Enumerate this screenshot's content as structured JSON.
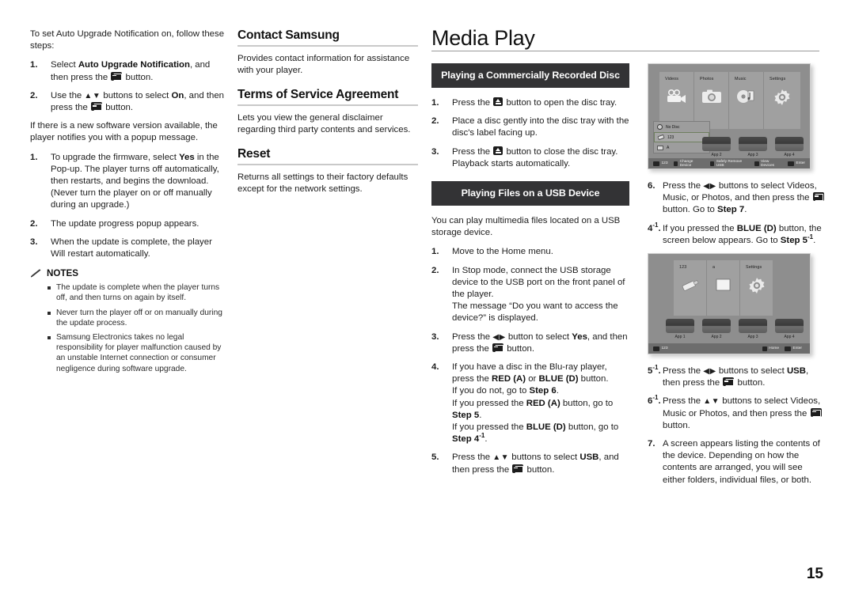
{
  "page": {
    "title": "Media Play",
    "number": "15"
  },
  "column1": {
    "intro": "To set Auto Upgrade Notification on, follow these steps:",
    "steps_a": [
      {
        "num": "1.",
        "parts": [
          "Select ",
          "Auto Upgrade Notification",
          ", and then press the ",
          "[ENTER]",
          " button."
        ]
      },
      {
        "num": "2.",
        "parts": [
          "Use the ",
          "▲▼",
          " buttons to select ",
          "On",
          ", and then press the ",
          "[ENTER]",
          " button."
        ]
      }
    ],
    "middle": "If there is a new software version available, the player notifies you with a popup message.",
    "steps_b": [
      {
        "num": "1.",
        "parts": [
          "To upgrade the firmware, select ",
          "Yes",
          " in the Pop-up. The player turns off automatically, then restarts, and begins the download. (Never turn the player on or off manually during an upgrade.)"
        ]
      },
      {
        "num": "2.",
        "parts": [
          "The update progress popup appears."
        ]
      },
      {
        "num": "3.",
        "parts": [
          "When the update is complete, the player Will restart automatically."
        ]
      }
    ],
    "notes_title": "NOTES",
    "notes": [
      "The update is complete when the player turns off, and then turns on again  by itself.",
      "Never turn the player off or on manually during the update process.",
      "Samsung Electronics takes no legal responsibility for player malfunction caused by an unstable Internet connection or consumer negligence during software upgrade."
    ]
  },
  "column2": {
    "sections": [
      {
        "heading": "Contact Samsung",
        "body": "Provides contact information for assistance with your player."
      },
      {
        "heading": "Terms of Service Agreement",
        "body": "Lets you view the general disclaimer regarding third party contents and services."
      },
      {
        "heading": "Reset",
        "body": "Returns all settings to their factory defaults except for the network settings."
      }
    ]
  },
  "column3": {
    "banner1": "Playing a Commercially Recorded Disc",
    "disc_steps": [
      {
        "num": "1.",
        "pre": "Press the ",
        "icon": "eject-button",
        "post": " button to open the disc tray."
      },
      {
        "num": "2.",
        "pre": "Place a disc gently into the disc tray with the disc's label facing up.",
        "icon": "",
        "post": ""
      },
      {
        "num": "3.",
        "pre": "Press the ",
        "icon": "eject-button",
        "post": " button to close the disc tray. Playback starts automatically."
      }
    ],
    "banner2": "Playing Files on a USB Device",
    "usb_intro": "You can play multimedia files located on a USB storage device.",
    "usb_steps": [
      {
        "num": "1.",
        "text": "Move to the Home menu."
      },
      {
        "num": "2.",
        "text": "In Stop mode, connect the USB storage device to the USB port on the front panel of the player. The message “Do you want to access the device?” is displayed."
      },
      {
        "num": "3.",
        "text": "Press the ◀▶ button to select Yes, and then press the [ENTER] button."
      },
      {
        "num": "4.",
        "text": "If you have a disc in the Blu-ray player, press the RED (A) or BLUE (D) button. If you do not, go to Step 6. If you pressed the RED (A) button, go to Step 5. If you pressed the BLUE (D) button, go to Step 4-1."
      },
      {
        "num": "5.",
        "text": "Press the ▲▼ buttons to select USB, and then press the [ENTER] button."
      }
    ],
    "labels": {
      "step6": "Step 6",
      "step5": "Step 5",
      "step4_1": "Step 4",
      "step4_1_sup": "-1",
      "red_a": "RED (A)",
      "blue_d": "BLUE (D)",
      "yes": "Yes",
      "usb": "USB"
    }
  },
  "column4": {
    "steps": [
      {
        "num": "6.",
        "sup": "",
        "text": "Press the ◀▶ buttons to select Videos, Music, or Photos, and then press the [ENTER] button. Go to Step 7."
      },
      {
        "num": "4",
        "sup": "-1",
        "text": "If you pressed the BLUE (D) button, the screen below appears. Go to Step 5-1."
      },
      {
        "num": "5",
        "sup": "-1",
        "text": "Press the ◀▶ buttons to select USB, then press the [ENTER] button."
      },
      {
        "num": "6",
        "sup": "-1",
        "text": "Press the ▲▼ buttons to select Videos, Music or Photos, and then press the [ENTER] button."
      },
      {
        "num": "7.",
        "sup": "",
        "text": "A screen appears listing the contents of the device. Depending on how the contents are arranged, you will see either folders, individual files, or both."
      }
    ],
    "labels": {
      "step7": "Step 7",
      "step5_1": "Step 5",
      "step5_1_sup": "-1",
      "blue_d": "BLUE (D)",
      "usb": "USB"
    },
    "screenshot1": {
      "name": "home-menu-with-device-dropdown",
      "tiles": [
        {
          "label": "Videos",
          "icon": "camcorder-icon"
        },
        {
          "label": "Photos",
          "icon": "camera-icon"
        },
        {
          "label": "Music",
          "icon": "music-note-icon"
        },
        {
          "label": "Settings",
          "icon": "gear-icon"
        }
      ],
      "dropdown": [
        {
          "label": "No Disc",
          "icon": "disc-icon"
        },
        {
          "label": "123",
          "icon": "usb-icon"
        },
        {
          "label": "A",
          "icon": "folder-icon"
        }
      ],
      "apps": [
        "App 2",
        "App 3",
        "App 4"
      ],
      "bottombar": [
        {
          "key": "",
          "label": "123"
        },
        {
          "key": "A",
          "label": "Change Device"
        },
        {
          "key": "C",
          "label": "Safely Remove USB"
        },
        {
          "key": "D",
          "label": "View Devices"
        },
        {
          "key": "E",
          "label": "Enter"
        }
      ]
    },
    "screenshot2": {
      "name": "device-contents-screen",
      "tiles": [
        {
          "label": "123",
          "icon": "usb-icon"
        },
        {
          "label": "a",
          "icon": "folder-icon"
        },
        {
          "label": "Settings",
          "icon": "gear-icon"
        }
      ],
      "apps": [
        "App 1",
        "App 2",
        "App 3",
        "App 4"
      ],
      "bottombar": [
        {
          "key": "",
          "label": "123"
        },
        {
          "key": "H",
          "label": "Home"
        },
        {
          "key": "E",
          "label": "Enter"
        }
      ]
    }
  }
}
